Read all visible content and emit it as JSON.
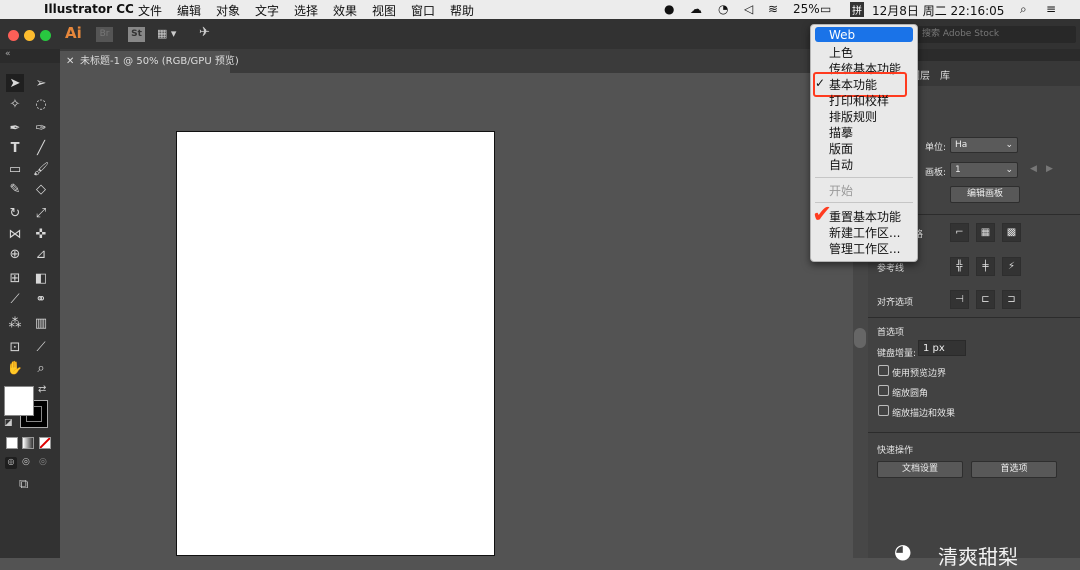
{
  "menubar": {
    "app_name": "Illustrator CC",
    "menus": [
      "文件",
      "编辑",
      "对象",
      "文字",
      "选择",
      "效果",
      "视图",
      "窗口",
      "帮助"
    ],
    "battery": "25%",
    "input_method": "拼",
    "datetime": "12月8日 周二  22:16:05"
  },
  "appbar": {
    "ai_logo": "Ai",
    "br_label": "Br",
    "st_label": "St",
    "stock_search_placeholder": "搜索 Adobe Stock"
  },
  "document": {
    "tab_title": "未标题-1 @ 50% (RGB/GPU 预览)"
  },
  "workspace_menu": {
    "items": [
      {
        "label": "Web",
        "highlighted": true
      },
      {
        "label": "上色"
      },
      {
        "label": "传统基本功能"
      },
      {
        "label": "基本功能",
        "checked": true,
        "check_glyph": "✓"
      },
      {
        "label": "打印和校样"
      },
      {
        "label": "排版规则"
      },
      {
        "label": "描摹"
      },
      {
        "label": "版面"
      },
      {
        "label": "自动"
      },
      {
        "label": "开始",
        "disabled": true
      },
      {
        "label": "重置基本功能"
      },
      {
        "label": "新建工作区..."
      },
      {
        "label": "管理工作区..."
      }
    ],
    "accent": "#1a73e8",
    "annotation_color": "#ff3b1f"
  },
  "panel": {
    "tabs": [
      "图层",
      "库"
    ],
    "tab_prefix": "属性",
    "doc_section_suffix": "档",
    "unit_label": "单位:",
    "unit_value": "Ha",
    "artboard_label": "画板:",
    "artboard_value": "1",
    "edit_artboard_button": "编辑画板",
    "ruler_grid_suffix": "格",
    "guides_label": "参考线",
    "snap_label": "对齐选项",
    "prefs_section": "首选项",
    "keyboard_increment_label": "键盘增量:",
    "keyboard_increment_value": "1 px",
    "options": [
      "使用预览边界",
      "缩放圆角",
      "缩放描边和效果"
    ],
    "quick_actions_label": "快速操作",
    "doc_setup_button": "文档设置",
    "prefs_button": "首选项",
    "watermark_text": "清爽甜梨"
  }
}
